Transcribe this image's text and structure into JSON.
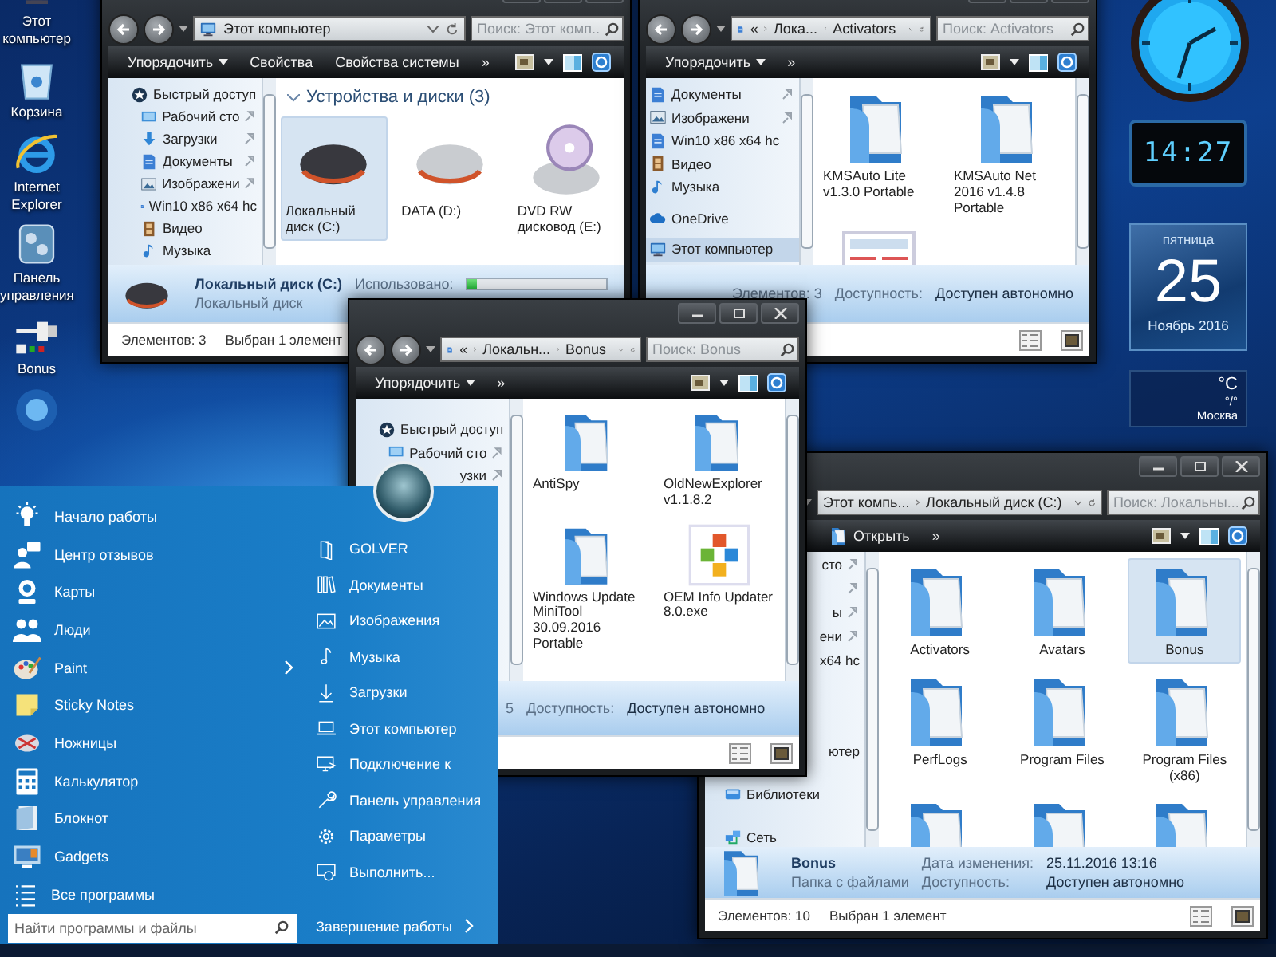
{
  "desktop_icons": [
    {
      "kind": "computer",
      "label": "Этот компьютер"
    },
    {
      "kind": "recycle-bin",
      "label": "Корзина"
    },
    {
      "kind": "browser",
      "label": "Internet Explorer"
    },
    {
      "kind": "control-panel",
      "label": "Панель управления"
    },
    {
      "kind": "shortcut",
      "label": "Bonus"
    },
    {
      "kind": "app"
    }
  ],
  "gadgets": {
    "digital_clock": "14:27",
    "calendar": {
      "weekday": "пятница",
      "day": "25",
      "month": "Ноябрь 2016"
    },
    "weather": {
      "unit": "°C",
      "reading": "°/°",
      "city": "Москва"
    }
  },
  "windows": [
    {
      "address": {
        "kind": "computer",
        "crumbs": [
          "Этот компьютер"
        ]
      },
      "search": {
        "placeholder": "Поиск: Этот комп..."
      },
      "toolbar": [
        {
          "kind": "menu",
          "label": "Упорядочить"
        },
        {
          "kind": "plain",
          "label": "Свойства"
        },
        {
          "kind": "plain",
          "label": "Свойства системы"
        },
        {
          "kind": "plain",
          "label": "»"
        }
      ],
      "sidebar": [
        {
          "kind": "quick",
          "label": "Быстрый доступ",
          "pinned": false,
          "selected": false,
          "clipped": false,
          "children": [
            {
              "kind": "desktop",
              "label": "Рабочий сто",
              "pinned": true,
              "selected": false,
              "clipped": false
            },
            {
              "kind": "download",
              "label": "Загрузки",
              "pinned": true,
              "selected": false,
              "clipped": false
            },
            {
              "kind": "docs",
              "label": "Документы",
              "pinned": true,
              "selected": false,
              "clipped": false
            },
            {
              "kind": "pictures",
              "label": "Изображени",
              "pinned": true,
              "selected": false,
              "clipped": false
            },
            {
              "kind": "docs",
              "label": "Win10 x86 x64 hc",
              "pinned": false,
              "selected": false,
              "clipped": false
            },
            {
              "kind": "video",
              "label": "Видео",
              "pinned": false,
              "selected": false,
              "clipped": false
            },
            {
              "kind": "music",
              "label": "Музыка",
              "pinned": false,
              "selected": false,
              "clipped": false
            }
          ]
        }
      ],
      "content": {
        "group": "Устройства и диски (3)",
        "items": [
          {
            "kind": "drive-dark",
            "label": "Локальный диск (C:)",
            "selected": true
          },
          {
            "kind": "drive-silver",
            "label": "DATA (D:)",
            "selected": false
          },
          {
            "kind": "optical-drive",
            "label": "DVD RW дисковод (E:)",
            "selected": false
          }
        ]
      },
      "details": {
        "kind": "drive-dark",
        "rows": [
          [
            {
              "kind": "name",
              "text": "Локальный диск (C:)"
            },
            {
              "kind": "label",
              "text": "Использовано:"
            },
            {
              "kind": "bar",
              "level": 0.07
            }
          ],
          [
            {
              "kind": "label",
              "text": "Локальный диск"
            }
          ]
        ]
      },
      "status": [
        "Элементов: 3",
        "Выбран 1 элемент"
      ]
    },
    {
      "address": {
        "kind": "folder",
        "overflow": "«",
        "crumbs": [
          "Лока...",
          "Activators"
        ]
      },
      "search": {
        "placeholder": "Поиск: Activators"
      },
      "toolbar": [
        {
          "kind": "menu",
          "label": "Упорядочить"
        },
        {
          "kind": "plain",
          "label": "»"
        }
      ],
      "sidebar": [
        {
          "children": [
            {
              "kind": "docs",
              "label": "Документы",
              "pinned": true,
              "selected": false,
              "clipped": false
            },
            {
              "kind": "pictures",
              "label": "Изображени",
              "pinned": true,
              "selected": false,
              "clipped": false
            },
            {
              "kind": "docs",
              "label": "Win10 x86 x64 hc",
              "pinned": false,
              "selected": false,
              "clipped": false
            },
            {
              "kind": "video",
              "label": "Видео",
              "pinned": false,
              "selected": false,
              "clipped": false
            },
            {
              "kind": "music",
              "label": "Музыка",
              "pinned": false,
              "selected": false,
              "clipped": false
            }
          ]
        },
        {
          "kind": "cloud",
          "label": "OneDrive",
          "pinned": false,
          "selected": false,
          "clipped": false
        },
        {
          "kind": "computer",
          "label": "Этот компьютер",
          "pinned": false,
          "selected": true,
          "clipped": false
        }
      ],
      "content": {
        "items": [
          {
            "kind": "folder",
            "label": "KMSAuto Lite v1.3.0 Portable",
            "selected": false
          },
          {
            "kind": "folder",
            "label": "KMSAuto Net 2016 v1.4.8 Portable",
            "selected": false
          },
          {
            "kind": "thumbnail",
            "selected": false
          }
        ]
      },
      "details": {
        "rows": [
          [
            {
              "kind": "label",
              "text": "Элементов: 3"
            },
            {
              "kind": "label",
              "text": "Доступность:"
            },
            {
              "kind": "value",
              "text": "Доступен автономно"
            }
          ]
        ]
      }
    },
    {
      "address": {
        "kind": "folder",
        "overflow": "«",
        "crumbs": [
          "Локальн...",
          "Bonus"
        ]
      },
      "search": {
        "placeholder": "Поиск: Bonus"
      },
      "toolbar": [
        {
          "kind": "menu",
          "label": "Упорядочить"
        },
        {
          "kind": "plain",
          "label": "»"
        }
      ],
      "sidebar": [
        {
          "kind": "quick",
          "label": "Быстрый доступ",
          "pinned": false,
          "selected": false,
          "clipped": false,
          "children": [
            {
              "kind": "desktop",
              "label": "Рабочий сто",
              "pinned": true,
              "selected": false,
              "clipped": false
            },
            {
              "label": "узки",
              "pinned": true,
              "selected": false,
              "clipped": true
            }
          ]
        }
      ],
      "content": {
        "items": [
          {
            "kind": "folder",
            "label": "AntiSpy",
            "selected": false
          },
          {
            "kind": "folder",
            "label": "OldNewExplorer v1.1.8.2",
            "selected": false
          },
          {
            "kind": "folder",
            "label": "Windows Update MiniTool 30.09.2016 Portable",
            "selected": false
          },
          {
            "kind": "installer",
            "label": "OEM Info Updater 8.0.exe",
            "selected": false
          }
        ]
      },
      "details": {
        "kind": "folder",
        "rows": [
          [
            {
              "kind": "count",
              "text": "5"
            },
            {
              "kind": "label",
              "text": "Доступность:"
            },
            {
              "kind": "value",
              "text": "Доступен автономно"
            }
          ]
        ]
      }
    },
    {
      "address": {
        "crumbs": [
          "Этот компь...",
          "Локальный диск (C:)"
        ]
      },
      "search": {
        "placeholder": "Поиск: Локальны..."
      },
      "toolbar": [
        {
          "kind": "open",
          "label": "Открыть"
        },
        {
          "kind": "plain",
          "label": "»"
        }
      ],
      "sidebar": [
        {
          "children": [
            {
              "label": "сто",
              "pinned": true,
              "selected": false,
              "clipped": true
            },
            {
              "pinned": true,
              "selected": false,
              "clipped": true
            },
            {
              "label": "ы",
              "pinned": true,
              "selected": false,
              "clipped": true
            },
            {
              "label": "ени",
              "pinned": true,
              "selected": false,
              "clipped": true
            },
            {
              "label": "x64 hc",
              "pinned": false,
              "selected": false,
              "clipped": true
            },
            {
              "pinned": false,
              "selected": false
            },
            {
              "pinned": false,
              "selected": false
            }
          ]
        },
        {
          "label": "ютер",
          "pinned": false,
          "selected": false,
          "clipped": true
        },
        {
          "kind": "library",
          "label": "Библиотеки",
          "pinned": false,
          "selected": false,
          "clipped": false
        },
        {
          "kind": "network",
          "label": "Сеть",
          "pinned": false,
          "selected": false,
          "clipped": false
        }
      ],
      "content": {
        "items": [
          {
            "kind": "folder",
            "label": "Activators",
            "selected": false
          },
          {
            "kind": "folder",
            "label": "Avatars",
            "selected": false
          },
          {
            "kind": "folder",
            "label": "Bonus",
            "selected": true
          },
          {
            "kind": "folder",
            "label": "PerfLogs",
            "selected": false
          },
          {
            "kind": "folder",
            "label": "Program Files",
            "selected": false
          },
          {
            "kind": "folder",
            "label": "Program Files (x86)",
            "selected": false
          },
          {
            "kind": "folder",
            "selected": false
          },
          {
            "kind": "folder",
            "selected": false
          },
          {
            "kind": "folder",
            "selected": false
          }
        ]
      },
      "details": {
        "kind": "folder",
        "rows": [
          [
            {
              "kind": "name",
              "text": "Bonus"
            },
            {
              "kind": "label",
              "text": "Дата изменения:"
            },
            {
              "kind": "value",
              "text": "25.11.2016 13:16"
            }
          ],
          [
            {
              "kind": "label",
              "text": "Папка с файлами"
            },
            {
              "kind": "label",
              "text": "Доступность:"
            },
            {
              "kind": "value",
              "text": "Доступен автономно"
            }
          ]
        ]
      },
      "status": [
        "Элементов: 10",
        "Выбран 1 элемент"
      ]
    }
  ],
  "start_menu": {
    "left_items": [
      {
        "kind": "bulb",
        "label": "Начало работы",
        "submenu": false
      },
      {
        "kind": "feedback",
        "label": "Центр отзывов",
        "submenu": false
      },
      {
        "kind": "maps",
        "label": "Карты",
        "submenu": false
      },
      {
        "kind": "people",
        "label": "Люди",
        "submenu": false
      },
      {
        "kind": "paint",
        "label": "Paint",
        "submenu": true
      },
      {
        "kind": "sticky",
        "label": "Sticky Notes",
        "submenu": false
      },
      {
        "kind": "scissors",
        "label": "Ножницы",
        "submenu": false
      },
      {
        "kind": "calculator",
        "label": "Калькулятор",
        "submenu": false
      },
      {
        "kind": "notepad",
        "label": "Блокнот",
        "submenu": false
      },
      {
        "kind": "gadgets",
        "label": "Gadgets",
        "submenu": false
      }
    ],
    "all_programs": "Все программы",
    "search": {
      "placeholder": "Найти программы и файлы"
    },
    "right_items": [
      {
        "kind": "user",
        "label": "GOLVER"
      },
      {
        "kind": "documents",
        "label": "Документы"
      },
      {
        "kind": "pictures-line",
        "label": "Изображения"
      },
      {
        "kind": "music-line",
        "label": "Музыка"
      },
      {
        "kind": "download-line",
        "label": "Загрузки"
      },
      {
        "kind": "laptop",
        "label": "Этот компьютер"
      },
      {
        "kind": "connect",
        "label": "Подключение к"
      },
      {
        "kind": "wrench",
        "label": "Панель управления"
      },
      {
        "kind": "settings",
        "label": "Параметры"
      },
      {
        "kind": "run",
        "label": "Выполнить..."
      }
    ],
    "shutdown": "Завершение работы"
  }
}
